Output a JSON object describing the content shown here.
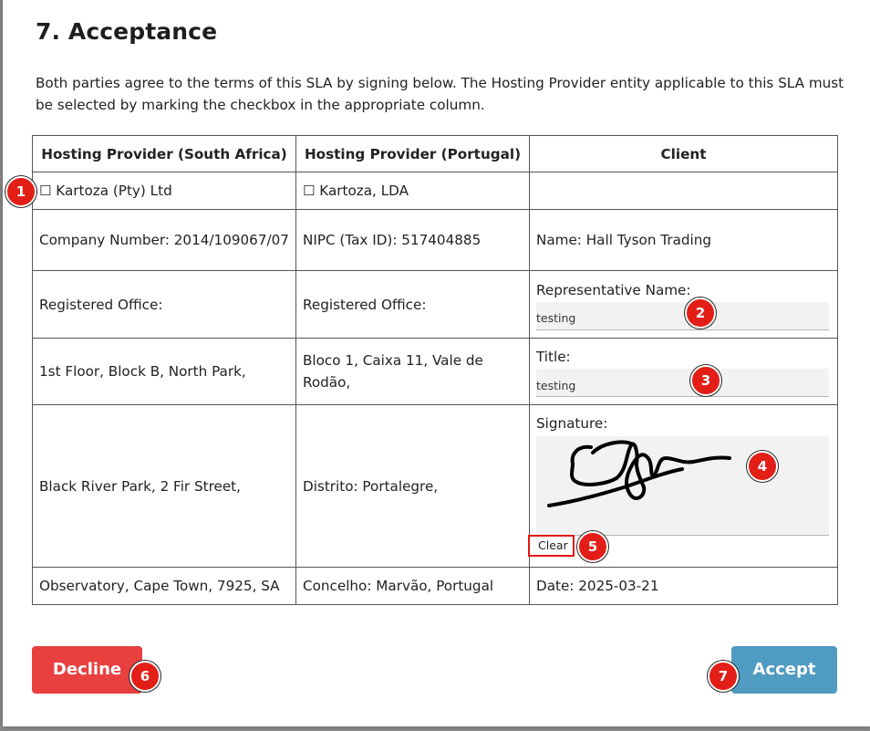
{
  "section": {
    "title": "7. Acceptance",
    "intro": "Both parties agree to the terms of this SLA by signing below. The Hosting Provider entity applicable to this SLA must be selected by marking the checkbox in the appropriate column."
  },
  "table": {
    "headers": [
      "Hosting Provider (South Africa)",
      "Hosting Provider (Portugal)",
      "Client"
    ],
    "za": {
      "checkbox_label": "Kartoza (Pty) Ltd",
      "company_number": "Company Number: 2014/109067/07",
      "registered_office": "Registered Office:",
      "address_1": "1st Floor, Block B, North Park,",
      "address_2": "Black River Park, 2 Fir Street,",
      "address_3": "Observatory, Cape Town, 7925, SA"
    },
    "pt": {
      "checkbox_label": "Kartoza, LDA",
      "tax_id": "NIPC (Tax ID): 517404885",
      "registered_office": "Registered Office:",
      "address_1": "Bloco 1, Caixa 11, Vale de Rodão,",
      "address_2": "Distrito: Portalegre,",
      "address_3": "Concelho: Marvão, Portugal"
    },
    "client": {
      "name": "Name: Hall Tyson Trading",
      "rep_label": "Representative Name:",
      "rep_value": "testing",
      "title_label": "Title:",
      "title_value": "testing",
      "signature_label": "Signature:",
      "clear_label": "Clear",
      "date": "Date: 2025-03-21"
    }
  },
  "buttons": {
    "decline": "Decline",
    "accept": "Accept"
  },
  "badges": [
    "1",
    "2",
    "3",
    "4",
    "5",
    "6",
    "7"
  ],
  "icons": {
    "checkbox": "☐"
  },
  "colors": {
    "decline": "#e8403f",
    "accept": "#4f9bc2",
    "badge": "#e21e17",
    "highlight": "#e81313"
  }
}
